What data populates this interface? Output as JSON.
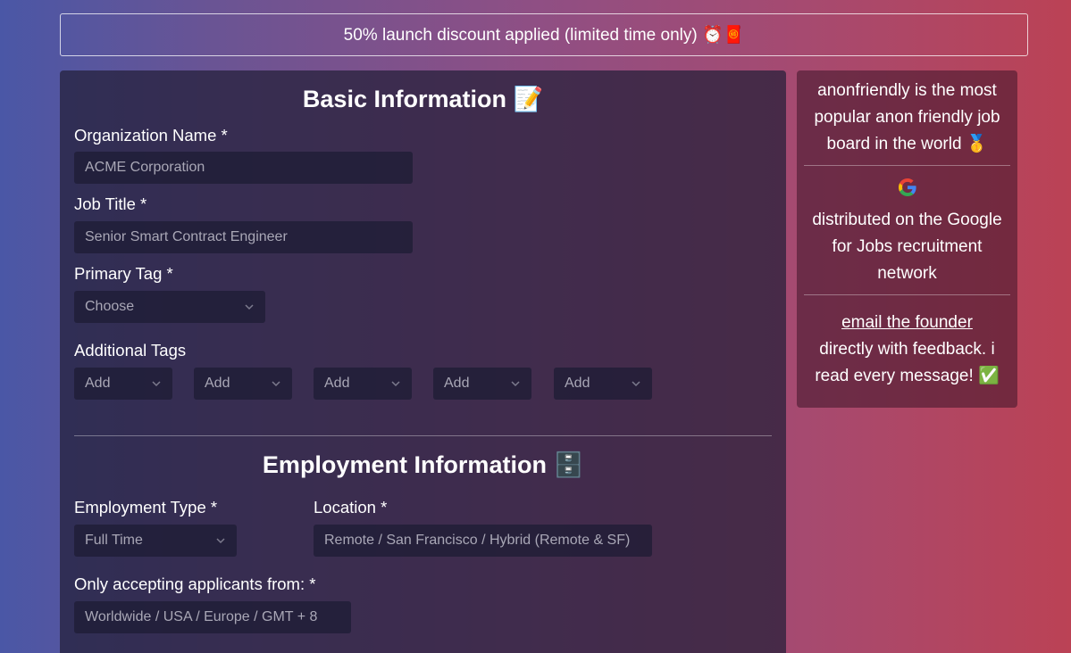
{
  "banner": {
    "text": "50% launch discount applied (limited time only) ⏰🧧"
  },
  "basic": {
    "title": "Basic Information 📝",
    "org_label": "Organization Name *",
    "org_placeholder": "ACME Corporation",
    "job_label": "Job Title *",
    "job_placeholder": "Senior Smart Contract Engineer",
    "primary_tag_label": "Primary Tag *",
    "primary_tag_value": "Choose",
    "additional_tags_label": "Additional Tags",
    "additional_tags": [
      "Add",
      "Add",
      "Add",
      "Add",
      "Add"
    ]
  },
  "employment": {
    "title": "Employment Information 🗄️",
    "type_label": "Employment Type *",
    "type_value": "Full Time",
    "location_label": "Location *",
    "location_placeholder": "Remote / San Francisco / Hybrid (Remote & SF)",
    "applicants_label": "Only accepting applicants from: *",
    "applicants_placeholder": "Worldwide / USA / Europe / GMT + 8"
  },
  "sidebar": {
    "popular_text": "anonfriendly is the most popular anon friendly job board in the world 🥇",
    "google_icon": "google-icon",
    "google_text": "distributed on the Google for Jobs recruitment network",
    "founder_link": "email the founder",
    "founder_text": "directly with feedback. i read every message! ✅"
  },
  "colors": {
    "input_bg": "#272540",
    "card_bg": "#2a2440",
    "placeholder": "#a9a7b6"
  }
}
